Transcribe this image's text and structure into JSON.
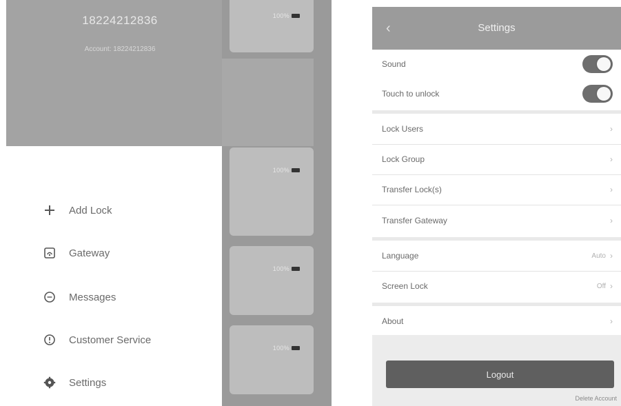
{
  "drawer": {
    "phone": "18224212836",
    "account": "Account: 18224212836",
    "menu": [
      {
        "label": "Add Lock",
        "icon": "plus-icon"
      },
      {
        "label": "Gateway",
        "icon": "gateway-icon"
      },
      {
        "label": "Messages",
        "icon": "messages-icon"
      },
      {
        "label": "Customer Service",
        "icon": "customer-service-icon"
      },
      {
        "label": "Settings",
        "icon": "gear-icon"
      }
    ]
  },
  "lock_list": {
    "battery_label": "100%"
  },
  "settings": {
    "title": "Settings",
    "rows": [
      {
        "label": "Sound",
        "type": "toggle",
        "on": true
      },
      {
        "label": "Touch to unlock",
        "type": "toggle",
        "on": true
      },
      {
        "label": "Lock Users",
        "type": "link",
        "value": ""
      },
      {
        "label": "Lock Group",
        "type": "link",
        "value": ""
      },
      {
        "label": "Transfer Lock(s)",
        "type": "link",
        "value": ""
      },
      {
        "label": "Transfer Gateway",
        "type": "link",
        "value": ""
      },
      {
        "label": "Language",
        "type": "link",
        "value": "Auto"
      },
      {
        "label": "Screen Lock",
        "type": "link",
        "value": "Off"
      },
      {
        "label": "About",
        "type": "link",
        "value": ""
      }
    ],
    "logout_label": "Logout",
    "delete_account_label": "Delete Account"
  },
  "colors": {
    "header_bg": "#9b9b9b",
    "toggle_on": "#6e6e6e",
    "logout_bg": "#5f5f5f"
  }
}
